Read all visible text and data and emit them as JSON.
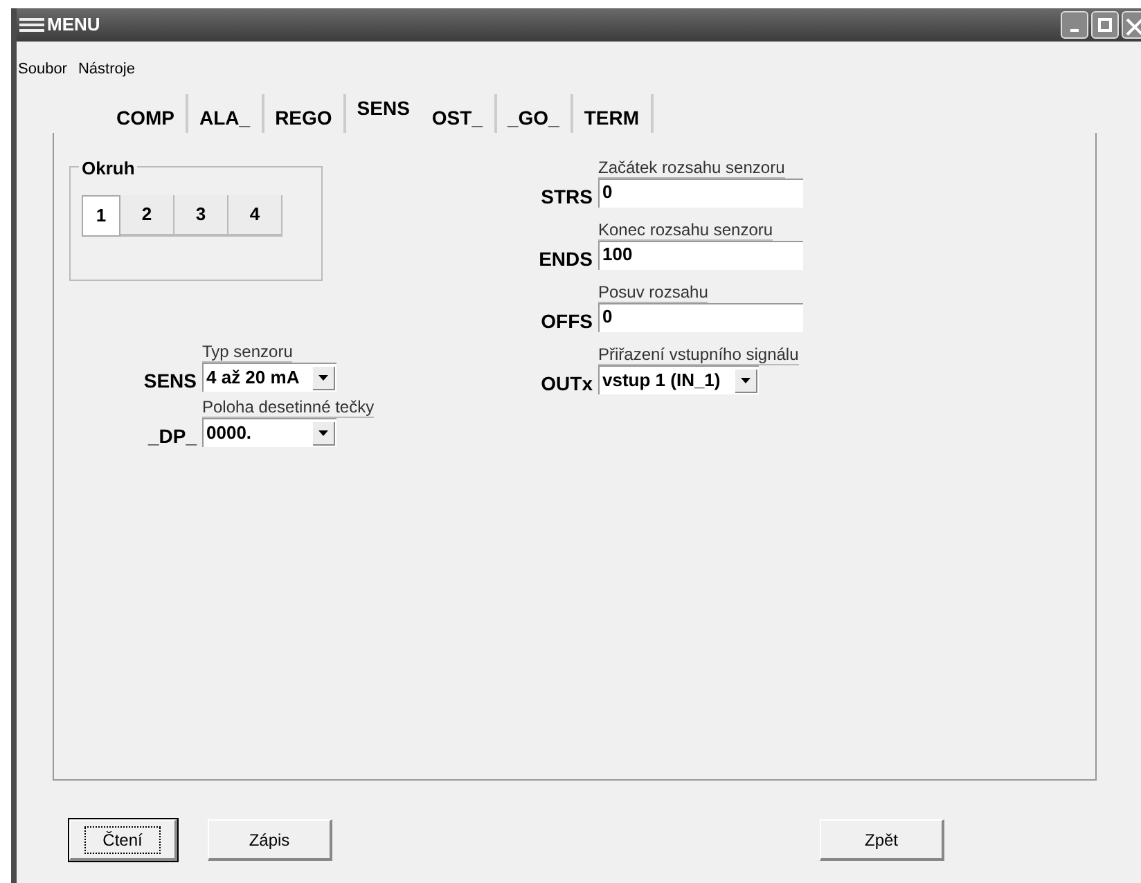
{
  "window": {
    "title": "MENU"
  },
  "menu": [
    "Soubor",
    "Nástroje"
  ],
  "tabs": [
    {
      "label": "COMP",
      "selected": false
    },
    {
      "label": "ALA_",
      "selected": false
    },
    {
      "label": "REGO",
      "selected": false
    },
    {
      "label": "SENS",
      "selected": true
    },
    {
      "label": "OST_",
      "selected": false
    },
    {
      "label": "_GO_",
      "selected": false
    },
    {
      "label": "TERM",
      "selected": false
    }
  ],
  "circuit_group": {
    "label": "Okruh",
    "buttons": [
      {
        "label": "1",
        "selected": true
      },
      {
        "label": "2",
        "selected": false
      },
      {
        "label": "3",
        "selected": false
      },
      {
        "label": "4",
        "selected": false
      }
    ]
  },
  "left_fields": [
    {
      "code": "SENS",
      "caption": "Typ senzoru",
      "value": "4 až 20 mA",
      "kind": "dropdown"
    },
    {
      "code": "_DP_",
      "caption": "Poloha desetinné tečky",
      "value": "0000.",
      "kind": "dropdown"
    }
  ],
  "right_fields": [
    {
      "code": "STRS",
      "caption": "Začátek rozsahu senzoru",
      "value": "0",
      "kind": "input"
    },
    {
      "code": "ENDS",
      "caption": "Konec rozsahu senzoru",
      "value": "100",
      "kind": "input"
    },
    {
      "code": "OFFS",
      "caption": "Posuv rozsahu",
      "value": "0",
      "kind": "input"
    },
    {
      "code": "OUTx",
      "caption": "Přiřazení vstupního signálu",
      "value": "vstup 1 (IN_1)",
      "kind": "dropdown"
    }
  ],
  "buttons": [
    {
      "label": "Čtení",
      "focused": true
    },
    {
      "label": "Zápis",
      "focused": false
    },
    {
      "label": "Zpět",
      "focused": false
    }
  ]
}
